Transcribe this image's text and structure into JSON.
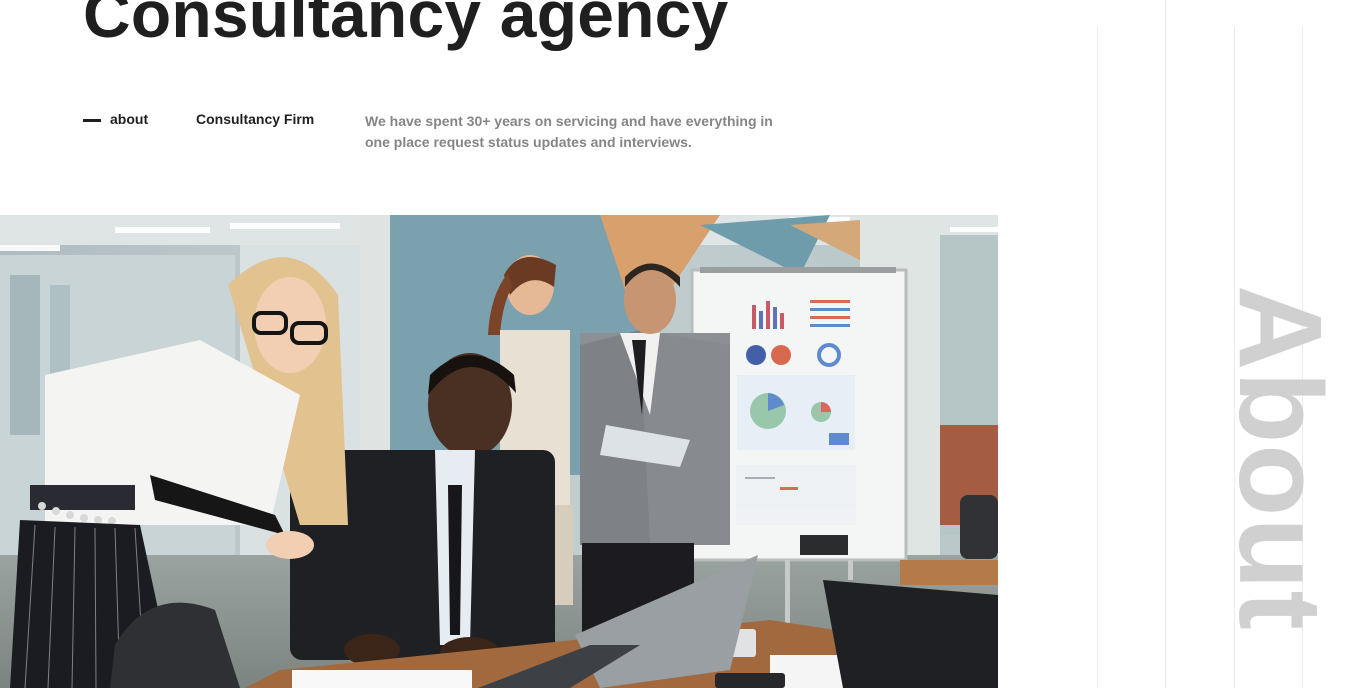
{
  "hero": {
    "title": "Consultancy agency"
  },
  "about": {
    "label": "about",
    "firm": "Consultancy Firm",
    "description": "We have spent 30+ years on servicing and have everything in one place request status updates and interviews."
  },
  "side": {
    "word": "About"
  },
  "image": {
    "alt": "Team of consultants working in a modern office"
  },
  "colors": {
    "text_dark": "#1f1f1f",
    "text_muted": "#858585",
    "side_word": "#d0d0d0",
    "guide_line": "#ececec"
  }
}
